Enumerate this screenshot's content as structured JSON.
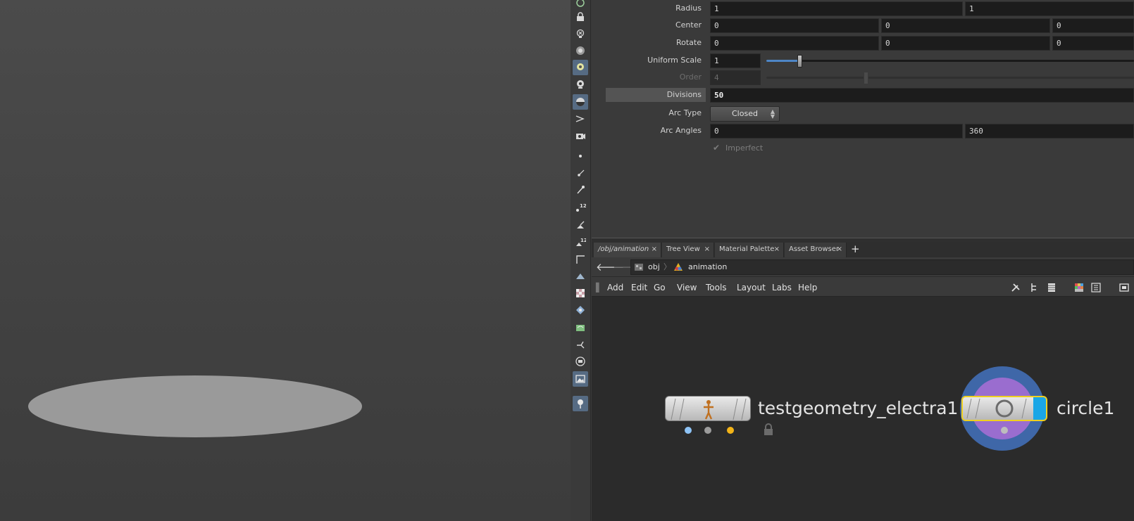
{
  "params": {
    "radius": {
      "label": "Radius",
      "values": [
        "1",
        "1"
      ]
    },
    "center": {
      "label": "Center",
      "values": [
        "0",
        "0",
        "0"
      ]
    },
    "rotate": {
      "label": "Rotate",
      "values": [
        "0",
        "0",
        "0"
      ]
    },
    "uniform_scale": {
      "label": "Uniform Scale",
      "value": "1",
      "slider_fraction": 0.09
    },
    "order": {
      "label": "Order",
      "value": "4",
      "disabled": true
    },
    "divisions": {
      "label": "Divisions",
      "value": "50"
    },
    "arc_type": {
      "label": "Arc Type",
      "value": "Closed"
    },
    "arc_angles": {
      "label": "Arc Angles",
      "values": [
        "0",
        "360"
      ]
    },
    "imperfect": {
      "label": "Imperfect",
      "checked": true,
      "disabled": true
    }
  },
  "tabs": [
    {
      "label": "/obj/animation",
      "active": true
    },
    {
      "label": "Tree View"
    },
    {
      "label": "Material Palette"
    },
    {
      "label": "Asset Browser"
    }
  ],
  "pathbar": {
    "crumbs": [
      "obj",
      "animation"
    ]
  },
  "network_menu": [
    "Add",
    "Edit",
    "Go",
    "View",
    "Tools",
    "Layout",
    "Labs",
    "Help"
  ],
  "nodes": [
    {
      "name": "testgeometry_electra1",
      "locked": true
    },
    {
      "name": "circle1",
      "selected": true,
      "display_flag": true
    }
  ],
  "colors": {
    "accent_blue": "#4e86c6",
    "selection_yellow": "#f0d020",
    "display_flag_blue": "#1aa6e6",
    "node_ring_blue": "#3f67a8",
    "node_ring_purple": "#9a6dcf",
    "dot_blue": "#8ec3f5",
    "dot_gray": "#9c9c9c",
    "dot_orange": "#f3b418"
  }
}
